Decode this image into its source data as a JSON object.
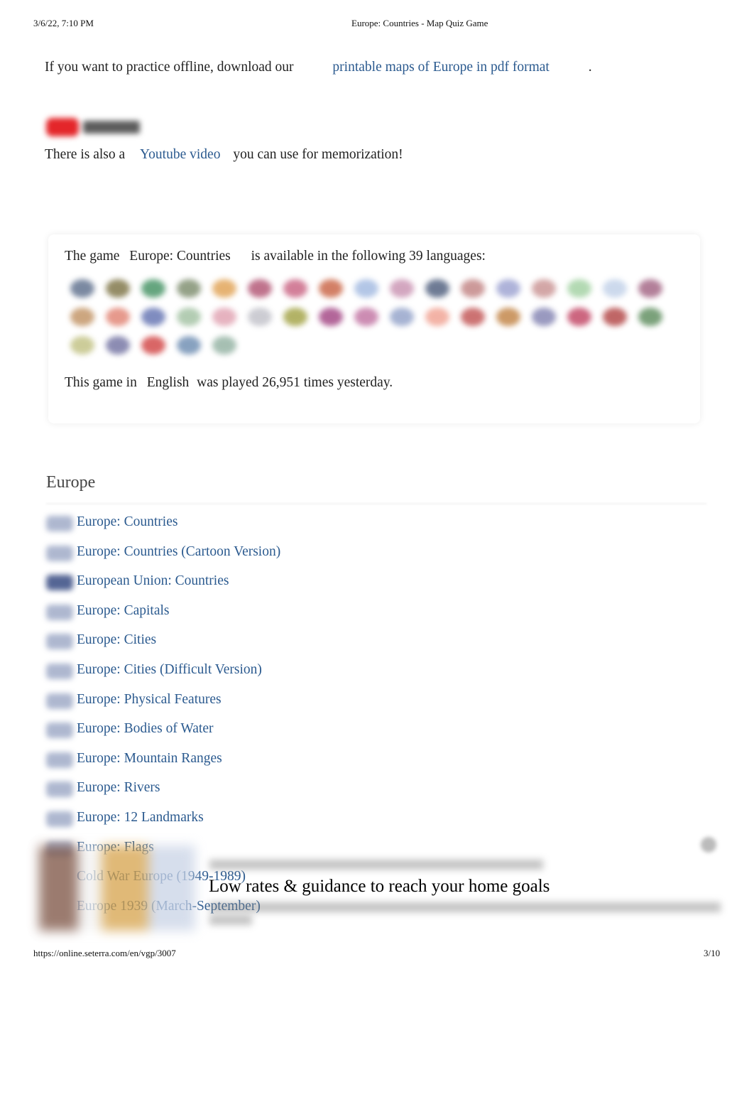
{
  "header": {
    "datetime": "3/6/22, 7:10 PM",
    "title": "Europe: Countries - Map Quiz Game"
  },
  "offline": {
    "text": "If you want to practice offline, download our",
    "link": "printable maps of Europe in pdf format",
    "end": "."
  },
  "youtube": {
    "logo_text": "YouTube",
    "pre": "There is also a",
    "link": "Youtube video",
    "post": "you can use for memorization!"
  },
  "languages": {
    "pre": "The game",
    "game": "Europe: Countries",
    "post": "is available in the following 39 languages:",
    "flag_colors": [
      "#5a6c8a",
      "#7a7040",
      "#3f8f5f",
      "#7a8a6a",
      "#e0a050",
      "#b05070",
      "#c86080",
      "#c86040",
      "#a0b8e0",
      "#c890b0",
      "#4a5a7a",
      "#c08080",
      "#9aa0d0",
      "#c89090",
      "#a0d0a0",
      "#c0d0e8",
      "#a06080",
      "#c09060",
      "#e08070",
      "#6070b0",
      "#a0c0a0",
      "#e0a0b0",
      "#c0c0c8",
      "#a0a040",
      "#a04080",
      "#c070a0",
      "#90a0c8",
      "#f0a090",
      "#c05050",
      "#c08040",
      "#8080b0",
      "#c04060",
      "#b04040",
      "#5a8a5a",
      "#c0c080",
      "#7070a0",
      "#d04040",
      "#6a8ab0",
      "#90b0a0"
    ],
    "played_pre": "This game in",
    "played_lang": "English",
    "played_post": "was played 26,951 times yesterday."
  },
  "section": {
    "title": "Europe",
    "items": [
      "Europe: Countries",
      "Europe: Countries (Cartoon Version)",
      "European Union: Countries",
      "Europe: Capitals",
      "Europe: Cities",
      "Europe: Cities (Difficult Version)",
      "Europe: Physical Features",
      "Europe: Bodies of Water",
      "Europe: Mountain Ranges",
      "Europe: Rivers",
      "Europe: 12 Landmarks",
      "Europe: Flags",
      "Cold War Europe (1949-1989)",
      "Europe 1939 (March-September)"
    ]
  },
  "ad": {
    "title": "Low rates & guidance to reach your home goals"
  },
  "footer": {
    "url": "https://online.seterra.com/en/vgp/3007",
    "page": "3/10"
  }
}
